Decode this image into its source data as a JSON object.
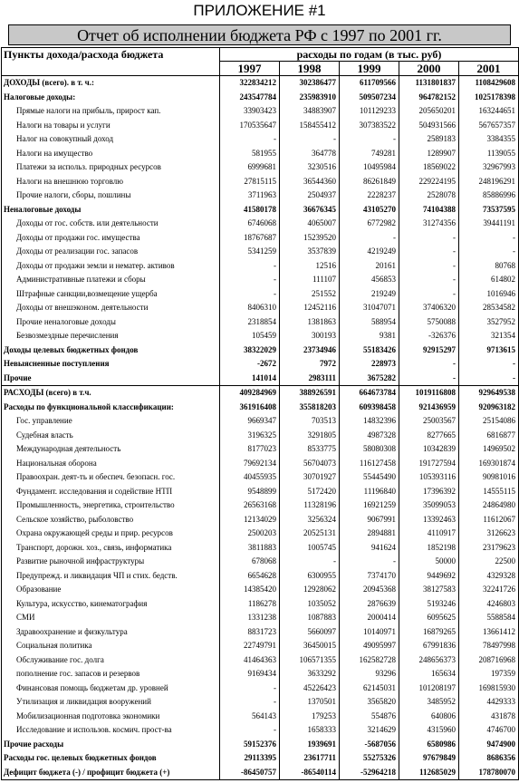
{
  "header": {
    "appendix": "ПРИЛОЖЕНИЕ #1",
    "title": "Отчет об исполнении бюджета РФ с 1997 по 2001 гг."
  },
  "table": {
    "col_label": "Пункты дохода/расхода бюджета",
    "col_group": "расходы по годам (в тыс. руб)",
    "years": [
      "1997",
      "1998",
      "1999",
      "2000",
      "2001"
    ],
    "rows": [
      {
        "label": "ДОХОДЫ (всего). в т. ч.:",
        "v": [
          "322834212",
          "302386477",
          "611709566",
          "1131801837",
          "1108429608"
        ],
        "bold": true,
        "indent": false
      },
      {
        "label": "Налоговые доходы:",
        "v": [
          "243547784",
          "235983910",
          "509507234",
          "964782152",
          "1025178398"
        ],
        "bold": true,
        "indent": false
      },
      {
        "label": "Прямые налоги на прибыль, прирост кап.",
        "v": [
          "33903423",
          "34883907",
          "101129233",
          "205650201",
          "163244651"
        ],
        "bold": false,
        "indent": true
      },
      {
        "label": "Налоги на товары и услуги",
        "v": [
          "170535647",
          "158455412",
          "307383522",
          "504931566",
          "567657357"
        ],
        "bold": false,
        "indent": true
      },
      {
        "label": "Налог на совокупный доход",
        "v": [
          "-",
          "-",
          "-",
          "2589183",
          "3384355"
        ],
        "bold": false,
        "indent": true
      },
      {
        "label": "Налоги на имущество",
        "v": [
          "581955",
          "364778",
          "749281",
          "1289907",
          "1139055"
        ],
        "bold": false,
        "indent": true
      },
      {
        "label": "Платежи за использ. природных ресурсов",
        "v": [
          "6999681",
          "3230516",
          "10495984",
          "18569022",
          "32967993"
        ],
        "bold": false,
        "indent": true
      },
      {
        "label": "Налоги на внешнюю торговлю",
        "v": [
          "27815115",
          "36544360",
          "86261849",
          "229224195",
          "248196291"
        ],
        "bold": false,
        "indent": true
      },
      {
        "label": "Прочие налоги, сборы, пошлины",
        "v": [
          "3711963",
          "2504937",
          "2228237",
          "2528078",
          "85886996"
        ],
        "bold": false,
        "indent": true
      },
      {
        "label": "Неналоговые доходы",
        "v": [
          "41580178",
          "36676345",
          "43105270",
          "74104388",
          "73537595"
        ],
        "bold": true,
        "indent": false
      },
      {
        "label": "Доходы от гос. собств. или деятельности",
        "v": [
          "6746068",
          "4065007",
          "6772982",
          "31274356",
          "39441191"
        ],
        "bold": false,
        "indent": true
      },
      {
        "label": "Доходы от продажи гос. имущества",
        "v": [
          "18767687",
          "15239520",
          "-",
          "-",
          "-"
        ],
        "bold": false,
        "indent": true
      },
      {
        "label": "Доходы от реализации гос. запасов",
        "v": [
          "5341259",
          "3537839",
          "4219249",
          "-",
          "-"
        ],
        "bold": false,
        "indent": true
      },
      {
        "label": "Доходы от продажи земли и нематер. активов",
        "v": [
          "-",
          "12516",
          "20161",
          "-",
          "80768"
        ],
        "bold": false,
        "indent": true
      },
      {
        "label": "Административные платежи и сборы",
        "v": [
          "-",
          "111107",
          "456853",
          "-",
          "614802"
        ],
        "bold": false,
        "indent": true
      },
      {
        "label": "Штрафные санкции,возмещение ущерба",
        "v": [
          "-",
          "251552",
          "219249",
          "-",
          "1016946"
        ],
        "bold": false,
        "indent": true
      },
      {
        "label": "Доходы от внешэконом. деятельности",
        "v": [
          "8406310",
          "12452116",
          "31047071",
          "37406320",
          "28534582"
        ],
        "bold": false,
        "indent": true
      },
      {
        "label": "Прочие неналоговые доходы",
        "v": [
          "2318854",
          "1381863",
          "588954",
          "5750088",
          "3527952"
        ],
        "bold": false,
        "indent": true
      },
      {
        "label": "Безвозмездные перечисления",
        "v": [
          "105459",
          "300193",
          "9381",
          "-326376",
          "321354"
        ],
        "bold": false,
        "indent": true
      },
      {
        "label": "Доходы целевых бюджетных фондов",
        "v": [
          "38322029",
          "23734946",
          "55183426",
          "92915297",
          "9713615"
        ],
        "bold": true,
        "indent": false
      },
      {
        "label": "Невыясненные поступления",
        "v": [
          "-2672",
          "7972",
          "228973",
          "-",
          "-"
        ],
        "bold": true,
        "indent": false
      },
      {
        "label": "Прочие",
        "v": [
          "141014",
          "2983111",
          "3675282",
          "-",
          "-"
        ],
        "bold": true,
        "indent": false
      },
      {
        "label": "РАСХОДЫ (всего)   в т.ч.",
        "v": [
          "409284969",
          "388926591",
          "664673784",
          "1019116808",
          "929649538"
        ],
        "bold": true,
        "indent": false,
        "sep": true
      },
      {
        "label": "Расходы по функциональной классификации:",
        "v": [
          "361916408",
          "355818203",
          "609398458",
          "921436959",
          "920963182"
        ],
        "bold": true,
        "indent": false
      },
      {
        "label": "Гос. управление",
        "v": [
          "9669347",
          "703513",
          "14832396",
          "25003567",
          "25154086"
        ],
        "bold": false,
        "indent": true
      },
      {
        "label": "Судебная власть",
        "v": [
          "3196325",
          "3291805",
          "4987328",
          "8277665",
          "6816877"
        ],
        "bold": false,
        "indent": true
      },
      {
        "label": "Международная деятельность",
        "v": [
          "8177023",
          "8533775",
          "58080308",
          "10342839",
          "14969502"
        ],
        "bold": false,
        "indent": true
      },
      {
        "label": "Национальная оборона",
        "v": [
          "79692134",
          "56704073",
          "116127458",
          "191727594",
          "169301874"
        ],
        "bold": false,
        "indent": true
      },
      {
        "label": "Правоохран. деят-ть и обеспеч. безопасн. гос.",
        "v": [
          "40455935",
          "30701927",
          "55445490",
          "105393116",
          "90981016"
        ],
        "bold": false,
        "indent": true
      },
      {
        "label": "Фундамент. исследования и содействие НТП",
        "v": [
          "9548899",
          "5172420",
          "11196840",
          "17396392",
          "14555115"
        ],
        "bold": false,
        "indent": true
      },
      {
        "label": "Промышленность, энергетика, строительство",
        "v": [
          "26563168",
          "11328196",
          "16921259",
          "35099053",
          "24864980"
        ],
        "bold": false,
        "indent": true
      },
      {
        "label": "Сельское хозяйство, рыболовство",
        "v": [
          "12134029",
          "3256324",
          "9067991",
          "13392463",
          "11612067"
        ],
        "bold": false,
        "indent": true
      },
      {
        "label": "Охрана окружающей среды и прир. ресурсов",
        "v": [
          "2500203",
          "20525131",
          "2894881",
          "4110917",
          "3126623"
        ],
        "bold": false,
        "indent": true
      },
      {
        "label": "Транспорт, дорожн. хоз., связь, информатика",
        "v": [
          "3811883",
          "1005745",
          "941624",
          "1852198",
          "23179623"
        ],
        "bold": false,
        "indent": true
      },
      {
        "label": "Развитие рыночной инфраструктуры",
        "v": [
          "678068",
          "-",
          "-",
          "50000",
          "22500"
        ],
        "bold": false,
        "indent": true
      },
      {
        "label": "Предупрежд. и ликвидация ЧП и стих. бедств.",
        "v": [
          "6654628",
          "6300955",
          "7374170",
          "9449692",
          "4329328"
        ],
        "bold": false,
        "indent": true
      },
      {
        "label": "Образование",
        "v": [
          "14385420",
          "12928062",
          "20945368",
          "38127583",
          "32241726"
        ],
        "bold": false,
        "indent": true
      },
      {
        "label": "Культура, искусство, кинематография",
        "v": [
          "1186278",
          "1035052",
          "2876639",
          "5193246",
          "4246803"
        ],
        "bold": false,
        "indent": true
      },
      {
        "label": "СМИ",
        "v": [
          "1331238",
          "1087883",
          "2000414",
          "6095625",
          "5588584"
        ],
        "bold": false,
        "indent": true
      },
      {
        "label": "Здравоохранение и физкультура",
        "v": [
          "8831723",
          "5660097",
          "10140971",
          "16879265",
          "13661412"
        ],
        "bold": false,
        "indent": true
      },
      {
        "label": "Социальная политика",
        "v": [
          "22749791",
          "36450015",
          "49095997",
          "67991836",
          "78497998"
        ],
        "bold": false,
        "indent": true
      },
      {
        "label": "Обслуживание гос. долга",
        "v": [
          "41464363",
          "106571355",
          "162582728",
          "248656373",
          "208716968"
        ],
        "bold": false,
        "indent": true
      },
      {
        "label": "пополнение гос. запасов и резервов",
        "v": [
          "9169434",
          "3633292",
          "93296",
          "165634",
          "197359"
        ],
        "bold": false,
        "indent": true
      },
      {
        "label": "Финансовая помощь бюджетам др. уровней",
        "v": [
          "-",
          "45226423",
          "62145031",
          "101208197",
          "169815930"
        ],
        "bold": false,
        "indent": true
      },
      {
        "label": "Утилизация и ликвидация вооружений",
        "v": [
          "-",
          "1370501",
          "3565820",
          "3485952",
          "4429333"
        ],
        "bold": false,
        "indent": true
      },
      {
        "label": "Мобилизационная подготовка экономики",
        "v": [
          "564143",
          "179253",
          "554876",
          "640806",
          "431878"
        ],
        "bold": false,
        "indent": true
      },
      {
        "label": "Исследование и использов. космич. прост-ва",
        "v": [
          "-",
          "1658333",
          "3214629",
          "4315960",
          "4746700"
        ],
        "bold": false,
        "indent": true
      },
      {
        "label": "Прочие расходы",
        "v": [
          "59152376",
          "1939691",
          "-5687056",
          "6580986",
          "9474900"
        ],
        "bold": true,
        "indent": false
      },
      {
        "label": "Расходы гос. целевых бюджетных фондов",
        "v": [
          "29113395",
          "23617711",
          "55275326",
          "97679849",
          "8686356"
        ],
        "bold": true,
        "indent": false
      },
      {
        "label": "Дефицит бюджета (-) / профицит бюджета (+)",
        "v": [
          "-86450757",
          "-86540114",
          "-52964218",
          "112685029",
          "178780070"
        ],
        "bold": true,
        "indent": false
      }
    ]
  }
}
